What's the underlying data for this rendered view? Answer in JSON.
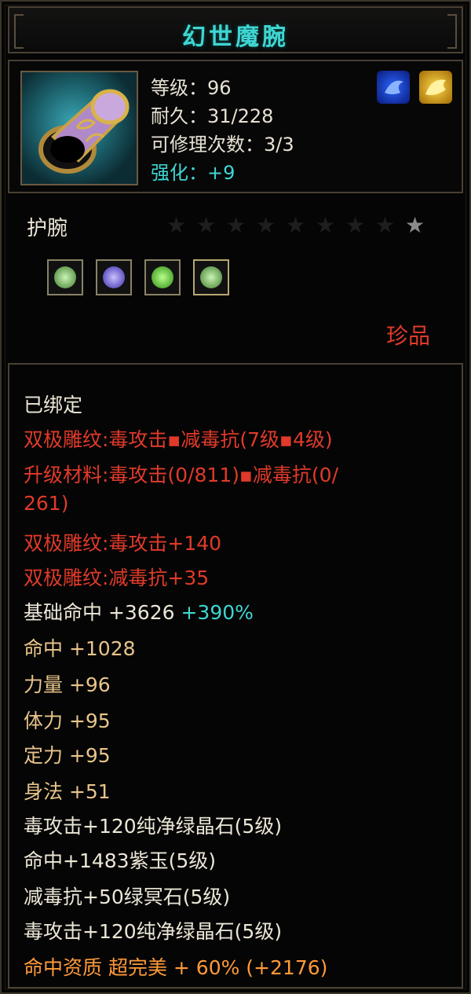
{
  "title": "幻世魔腕",
  "header": {
    "level": "等级：96",
    "durability": "耐久：31/228",
    "repair": "可修理次数：3/3",
    "enhance": "强化：+9",
    "item_icon": "wristguard-icon",
    "badges": [
      "blue-gem-badge-icon",
      "gold-dragon-badge-icon"
    ]
  },
  "type_label": "护腕",
  "stars": {
    "total": 9,
    "lit": 1
  },
  "gems": [
    {
      "name": "green-crystal-gem-icon",
      "color": "#7fd36a"
    },
    {
      "name": "purple-jade-gem-icon",
      "color": "#6b5cff"
    },
    {
      "name": "green-gem-icon",
      "color": "#4fd23a"
    },
    {
      "name": "green-crystal-gem-icon",
      "color": "#7fd36a"
    }
  ],
  "rarity": "珍品",
  "lines": {
    "bound": "已绑定",
    "engrave1": "双极雕纹:毒攻击▪减毒抗(7级▪4级)",
    "upgrade1": "升级材料:毒攻击(0/811)▪减毒抗(0/",
    "upgrade2": "261)",
    "engrave2": "双极雕纹:毒攻击+140",
    "engrave3": "双极雕纹:减毒抗+35",
    "base_hit": "基础命中  +3626",
    "base_hit_pct": "+390%",
    "hit": "命中  +1028",
    "str": "力量  +96",
    "vit": "体力  +95",
    "focus": "定力  +95",
    "agi": "身法  +51",
    "gem1": "毒攻击+120纯净绿晶石(5级)",
    "gem2": "命中+1483紫玉(5级)",
    "gem3": "减毒抗+50绿冥石(5级)",
    "gem4": "毒攻击+120纯净绿晶石(5级)",
    "quality": "命中资质  超完美  + 60% (+2176)"
  },
  "colors": {
    "title": "#3fd6d2",
    "red": "#e03a2a",
    "gold": "#e8c48a",
    "orange": "#ff9a3a"
  }
}
